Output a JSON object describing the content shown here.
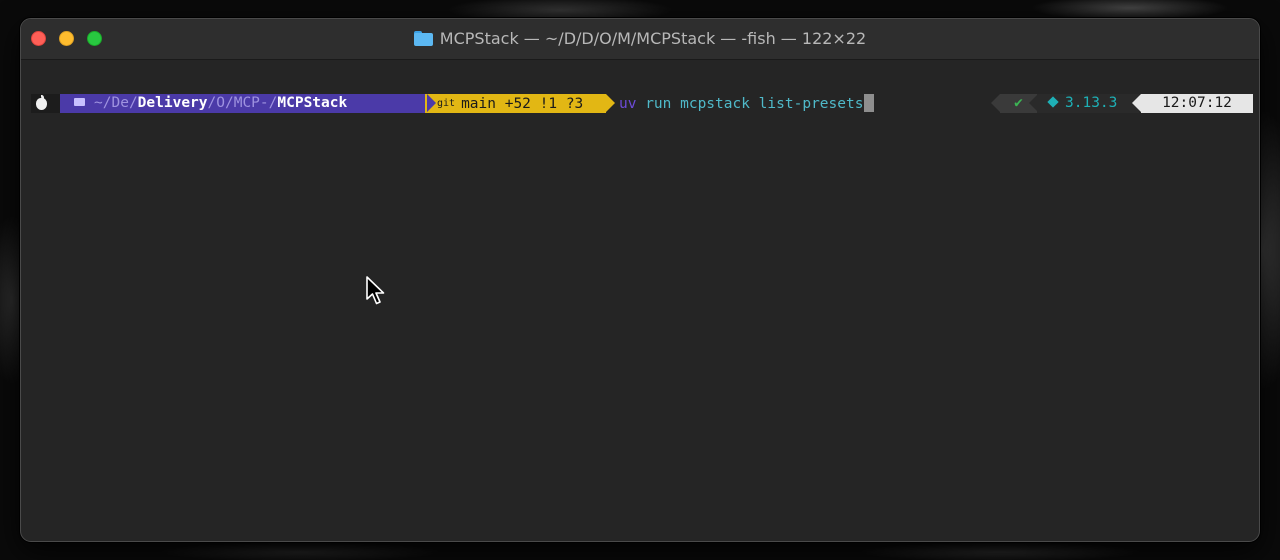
{
  "window": {
    "title": "MCPStack — ~/D/D/O/M/MCPStack — -fish — 122×22",
    "icon": "folder-icon"
  },
  "prompt": {
    "os_icon": "apple-icon",
    "path": {
      "folder_icon": "folder-icon",
      "home": "~/",
      "seg1": "De",
      "sep1": "/",
      "seg2": "Delivery",
      "sep2": "/O/",
      "seg3": "MCP-",
      "sep3": "/",
      "seg4": "MCPStack"
    },
    "git": {
      "icon_label": "git",
      "branch": "main",
      "status": "+52 !1 ?3"
    },
    "command": {
      "program": "uv",
      "args": " run mcpstack list-presets"
    }
  },
  "right_prompt": {
    "status": "✔",
    "python_version": "3.13.3",
    "time": "12:07:12"
  },
  "colors": {
    "path_bg": "#4b3aa8",
    "git_bg": "#e2b714",
    "command_fg": "#4fb9c9",
    "program_fg": "#6d4bd8",
    "time_bg": "#e6e6e6"
  }
}
